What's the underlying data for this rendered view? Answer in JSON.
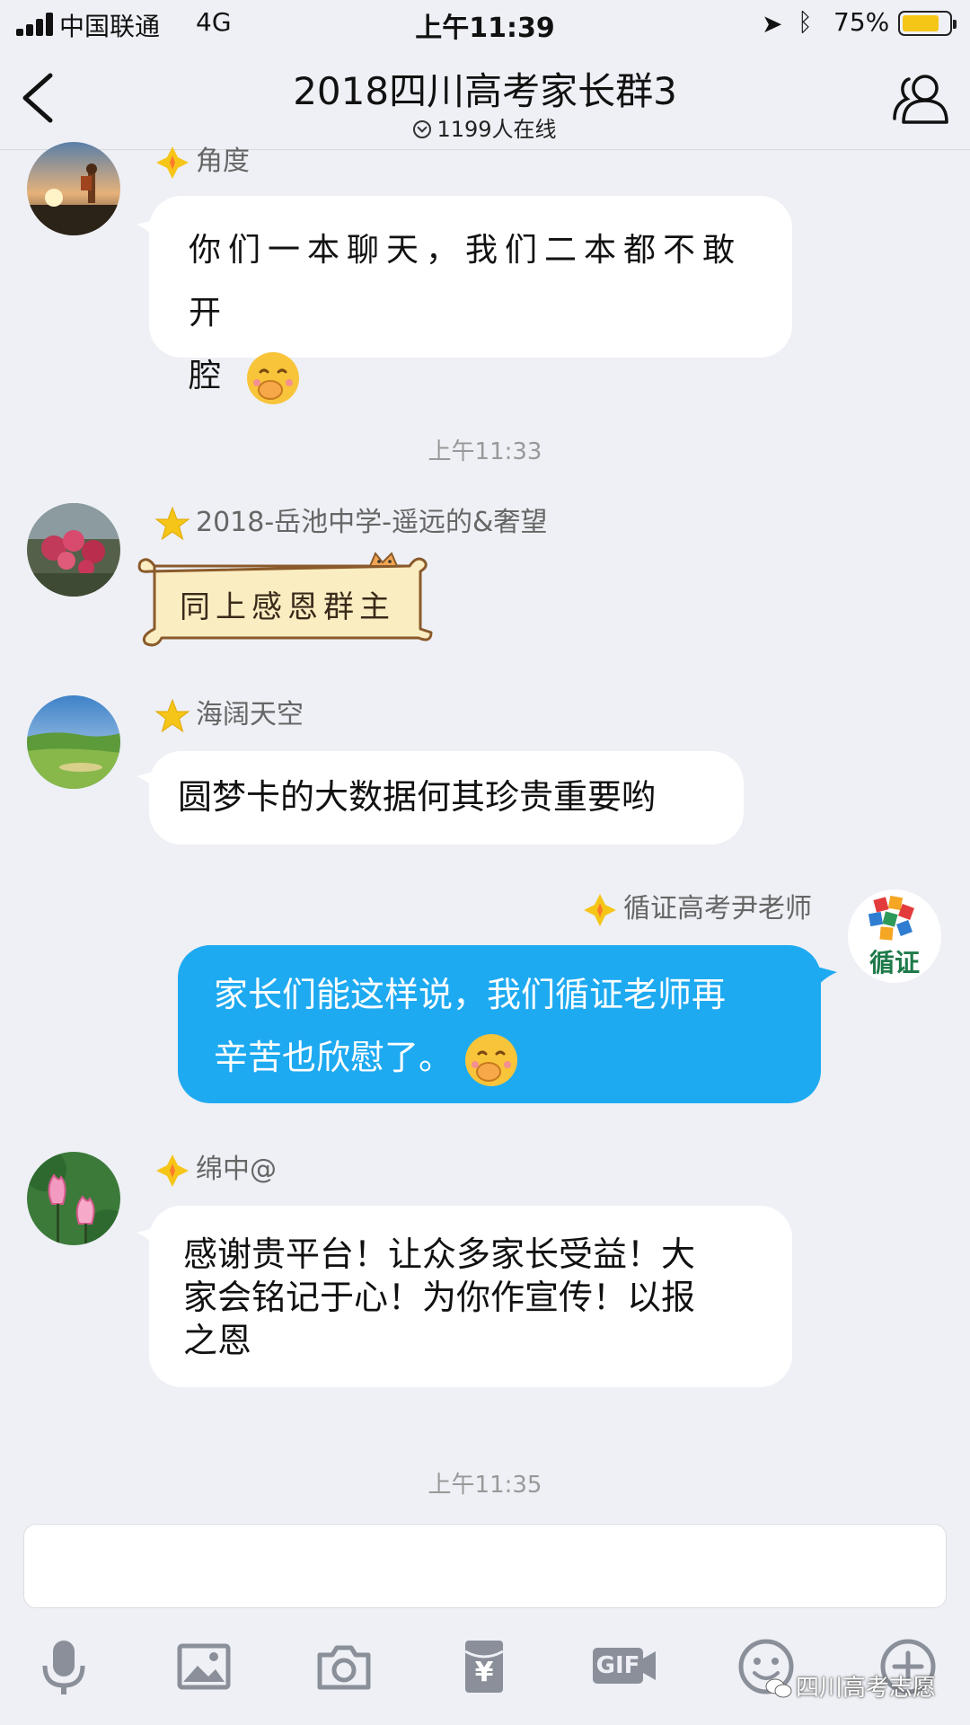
{
  "status": {
    "carrier": "中国联通",
    "network": "4G",
    "time": "上午11:39",
    "battery": "75%",
    "battery_level": 0.75
  },
  "nav": {
    "title": "2018四川高考家长群3",
    "online": "1199人在线"
  },
  "messages": [
    {
      "sender": "角度",
      "text_line1": "你们一本聊天，我们二本都不敢开",
      "text_line2": "腔",
      "emoji": "covering-mouth-emoji",
      "badge": "diamond-badge"
    },
    {
      "timestamp": "上午11:33"
    },
    {
      "sender": "2018-岳池中学-遥远的&奢望",
      "text": "同上感恩群主",
      "style": "sticker-bubble",
      "badge": "star-badge"
    },
    {
      "sender": "海阔天空",
      "text": "圆梦卡的大数据何其珍贵重要哟",
      "badge": "star-badge"
    },
    {
      "sender": "循证高考尹老师",
      "text_line1": "家长们能这样说，我们循证老师再",
      "text_line2": "辛苦也欣慰了。",
      "emoji": "covering-mouth-emoji",
      "avatar_text": "循证",
      "badge": "diamond-badge"
    },
    {
      "sender": "绵中@",
      "text_line1": "感谢贵平台！让众多家长受益！大",
      "text_line2": "家会铭记于心！为你作宣传！以报",
      "text_line3": "之恩",
      "badge": "diamond-badge"
    },
    {
      "timestamp": "上午11:35"
    }
  ],
  "toolbar": {
    "icons": [
      "microphone-icon",
      "image-icon",
      "camera-icon",
      "red-packet-icon",
      "gif-icon",
      "emoji-icon",
      "plus-icon"
    ],
    "gif_label": "GIF",
    "red_packet_label": "¥"
  },
  "watermark": "四川高考志愿",
  "colors": {
    "background": "#eef0f5",
    "self_bubble": "#1eaaf1",
    "badge_gold": "#f5c518"
  }
}
